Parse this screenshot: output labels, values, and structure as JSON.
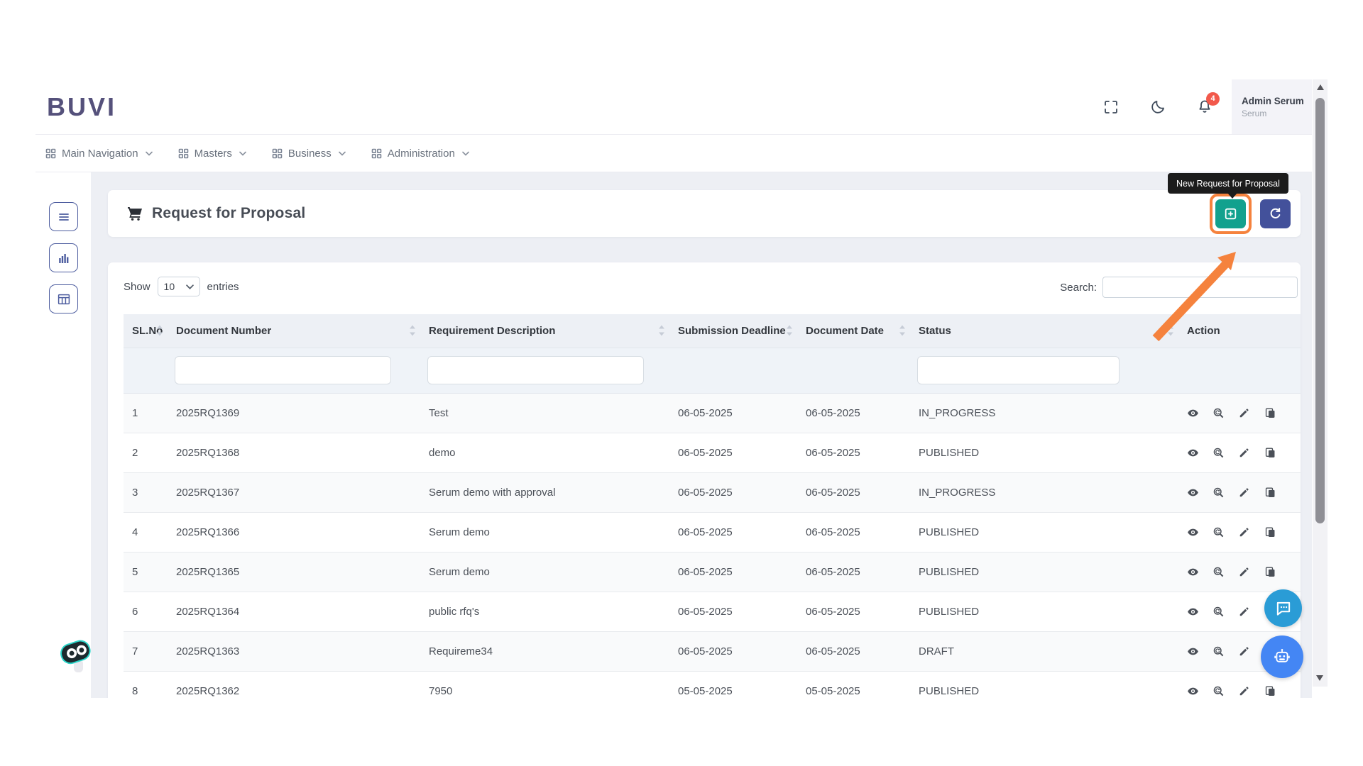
{
  "brand": {
    "logo_text": "BUVI"
  },
  "header": {
    "user": {
      "name": "Admin Serum",
      "role": "Serum"
    },
    "notifications": {
      "count": "4"
    }
  },
  "nav": {
    "items": [
      {
        "label": "Main Navigation"
      },
      {
        "label": "Masters"
      },
      {
        "label": "Business"
      },
      {
        "label": "Administration"
      }
    ]
  },
  "page": {
    "title": "Request for Proposal",
    "tooltip": "New Request for Proposal"
  },
  "controls": {
    "show_label": "Show",
    "page_size": "10",
    "entries_label": "entries",
    "search_label": "Search:",
    "search_value": ""
  },
  "table": {
    "columns": [
      {
        "label": "SL.No",
        "sortable": true,
        "filter": false
      },
      {
        "label": "Document Number",
        "sortable": true,
        "filter": true
      },
      {
        "label": "Requirement Description",
        "sortable": true,
        "filter": true
      },
      {
        "label": "Submission Deadline",
        "sortable": true,
        "filter": false
      },
      {
        "label": "Document Date",
        "sortable": true,
        "filter": false
      },
      {
        "label": "Status",
        "sortable": true,
        "filter": true
      },
      {
        "label": "Action",
        "sortable": false,
        "filter": false
      }
    ],
    "rows": [
      {
        "sl": "1",
        "document_number": "2025RQ1369",
        "requirement_description": "Test",
        "submission_deadline": "06-05-2025",
        "document_date": "06-05-2025",
        "status": "IN_PROGRESS"
      },
      {
        "sl": "2",
        "document_number": "2025RQ1368",
        "requirement_description": "demo",
        "submission_deadline": "06-05-2025",
        "document_date": "06-05-2025",
        "status": "PUBLISHED"
      },
      {
        "sl": "3",
        "document_number": "2025RQ1367",
        "requirement_description": "Serum demo with approval",
        "submission_deadline": "06-05-2025",
        "document_date": "06-05-2025",
        "status": "IN_PROGRESS"
      },
      {
        "sl": "4",
        "document_number": "2025RQ1366",
        "requirement_description": "Serum demo",
        "submission_deadline": "06-05-2025",
        "document_date": "06-05-2025",
        "status": "PUBLISHED"
      },
      {
        "sl": "5",
        "document_number": "2025RQ1365",
        "requirement_description": "Serum demo",
        "submission_deadline": "06-05-2025",
        "document_date": "06-05-2025",
        "status": "PUBLISHED"
      },
      {
        "sl": "6",
        "document_number": "2025RQ1364",
        "requirement_description": "public rfq's",
        "submission_deadline": "06-05-2025",
        "document_date": "06-05-2025",
        "status": "PUBLISHED"
      },
      {
        "sl": "7",
        "document_number": "2025RQ1363",
        "requirement_description": "Requireme34",
        "submission_deadline": "06-05-2025",
        "document_date": "06-05-2025",
        "status": "DRAFT"
      },
      {
        "sl": "8",
        "document_number": "2025RQ1362",
        "requirement_description": "7950",
        "submission_deadline": "05-05-2025",
        "document_date": "05-05-2025",
        "status": "PUBLISHED"
      }
    ],
    "action_icons": [
      "view-icon",
      "preview-icon",
      "edit-icon",
      "copy-icon"
    ]
  },
  "icons": {
    "fullscreen-icon": "corner brackets",
    "dark-mode-icon": "crescent moon",
    "notifications-bell-icon": "bell",
    "grid-icon": "2x2 squares",
    "chevron-down-icon": "chevron",
    "menu-icon": "hamburger lines",
    "bar-chart-icon": "vertical bars",
    "table-view-icon": "grid table",
    "cart-icon": "shopping cart",
    "add-square-icon": "plus in square",
    "refresh-icon": "circular arrow",
    "view-icon": "eye",
    "preview-icon": "magnifier with refresh",
    "edit-icon": "pencil",
    "copy-icon": "stacked pages",
    "chat-icon": "speech bubble with dots",
    "robot-icon": "robot head"
  },
  "colors": {
    "accent_teal": "#12A18E",
    "accent_indigo": "#43519B",
    "annotation_orange": "#F5823D",
    "badge_red": "#F2594B",
    "chat_blue": "#2A9CD6",
    "bot_blue": "#4486F4",
    "logo_purple": "#55517B",
    "content_bg": "#EDEFF4"
  }
}
